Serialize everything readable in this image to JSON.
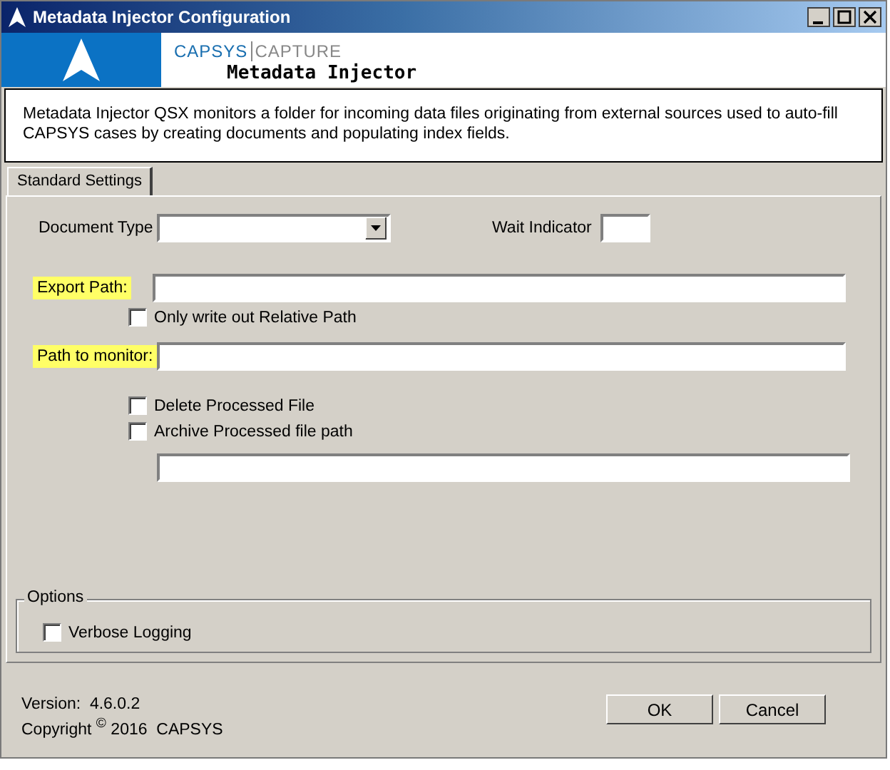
{
  "window": {
    "title": "Metadata Injector Configuration"
  },
  "header": {
    "brand": "CAPSYS",
    "product": "CAPTURE",
    "app_name": "Metadata Injector"
  },
  "description": "Metadata Injector QSX monitors a folder for incoming data files originating from external sources used to auto-fill CAPSYS cases by creating documents and populating index fields.",
  "tabs": [
    {
      "label": "Standard Settings",
      "selected": true
    }
  ],
  "document_type": {
    "label": "Document Type"
  },
  "wait_indicator": {
    "label": "Wait Indicator"
  },
  "export_path": {
    "label": "Export Path:",
    "highlighted": true
  },
  "relative_path": {
    "label": "Only write out Relative Path",
    "checked": false
  },
  "path_to_monitor": {
    "label": "Path to monitor:",
    "highlighted": true
  },
  "file_options": [
    {
      "label": "Delete Processed File",
      "checked": false
    },
    {
      "label": "Archive Processed file path",
      "checked": false
    }
  ],
  "options": {
    "title": "Options",
    "items": [
      {
        "label": "Verbose Logging",
        "checked": false
      }
    ]
  },
  "footer": {
    "version": "Version:  4.6.0.2",
    "copyright": "Copyright $^{©}$ 2016  CAPSYS"
  },
  "buttons": [
    "OK",
    "Cancel"
  ]
}
